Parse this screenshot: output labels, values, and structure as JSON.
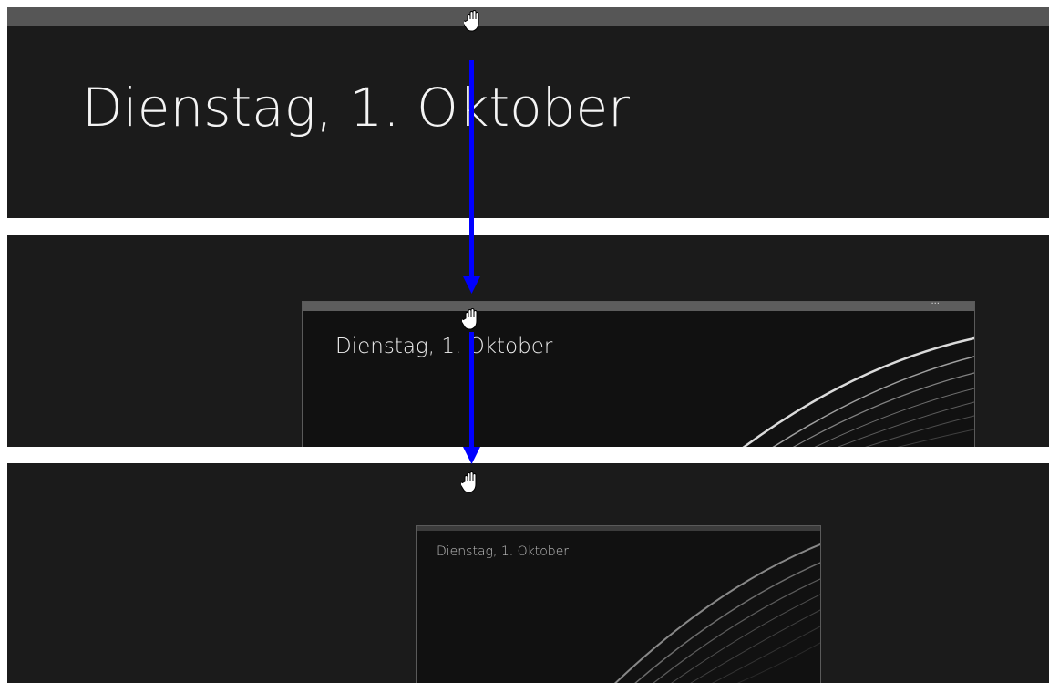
{
  "frames": [
    {
      "date_text": "Dienstag, 1. Oktober"
    },
    {
      "date_text": "Dienstag, 1. Oktober",
      "menu_icon": "ellipsis-icon"
    },
    {
      "date_text": "Dienstag, 1. Oktober",
      "menu_icon": "ellipsis-icon"
    }
  ],
  "window_menu_glyph": "···",
  "cursor_icon": "hand-grab-icon",
  "annotation": {
    "arrow_color": "#0000ff",
    "direction": "down"
  },
  "colors": {
    "background": "#1b1b1b",
    "titlebar": "#565656",
    "text": "#f4f4f4"
  }
}
